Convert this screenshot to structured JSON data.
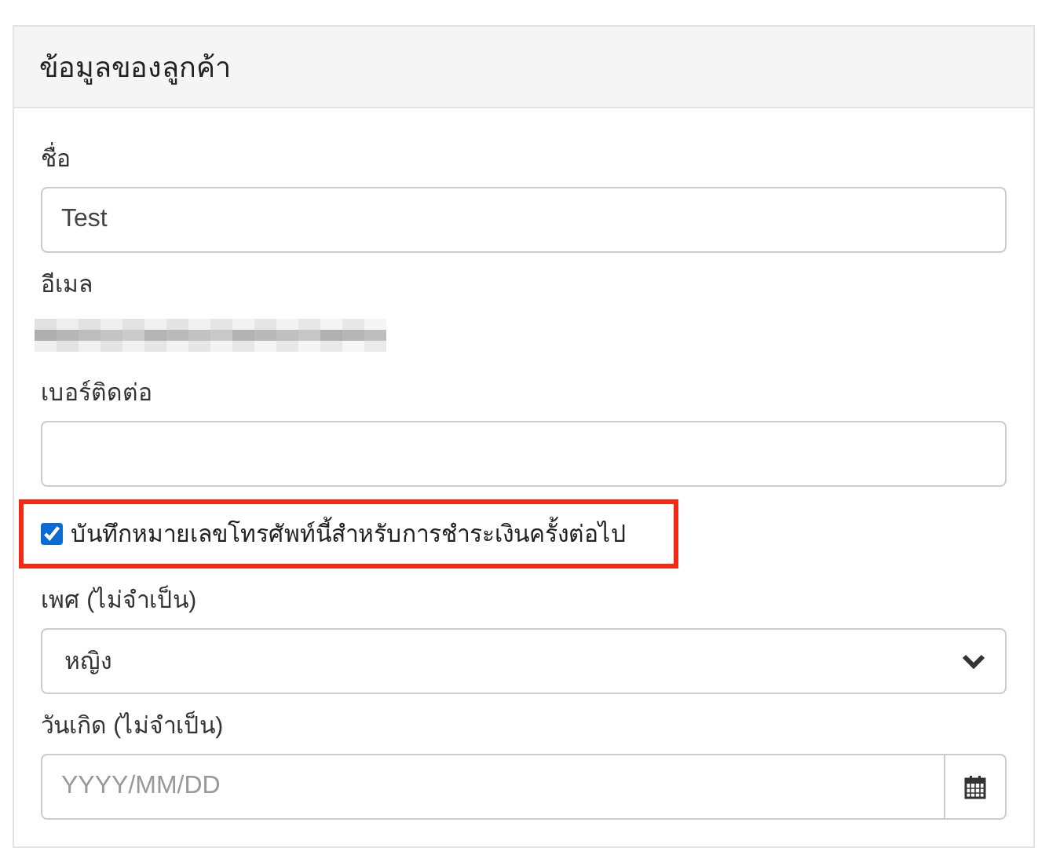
{
  "card": {
    "title": "ข้อมูลของลูกค้า"
  },
  "fields": [
    {
      "kind": "text",
      "label": "ชื่อ",
      "value": "Test"
    },
    {
      "kind": "redacted",
      "label": "อีเมล"
    },
    {
      "kind": "text",
      "label": "เบอร์ติดต่อ"
    },
    {
      "kind": "checkbox",
      "label": "บันทึกหมายเลขโทรศัพท์นี้สำหรับการชำระเงินครั้งต่อไป",
      "checked": true,
      "highlighted": true
    },
    {
      "kind": "select",
      "label": "เพศ (ไม่จำเป็น)",
      "value": "หญิง"
    },
    {
      "kind": "date",
      "label": "วันเกิด (ไม่จำเป็น)",
      "placeholder": "YYYY/MM/DD"
    }
  ]
}
